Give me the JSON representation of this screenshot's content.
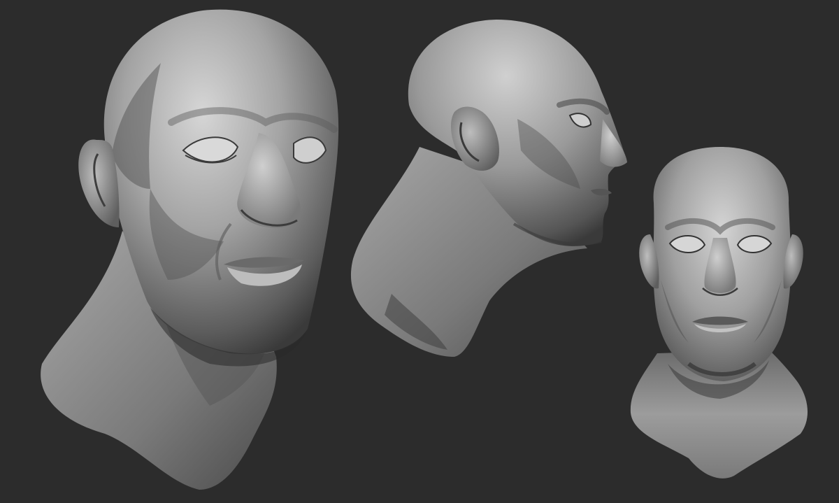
{
  "scene": {
    "background": "#2c2c2c",
    "material": "matcap-grey",
    "views": [
      {
        "name": "three-quarter-view"
      },
      {
        "name": "profile-view"
      },
      {
        "name": "front-view"
      }
    ]
  },
  "colors": {
    "background": "#2c2c2c",
    "skin_light": "#c9c9c9",
    "skin_mid": "#8e8e8e",
    "skin_dark": "#4a4a4a",
    "shadow": "#1c1c1c"
  }
}
